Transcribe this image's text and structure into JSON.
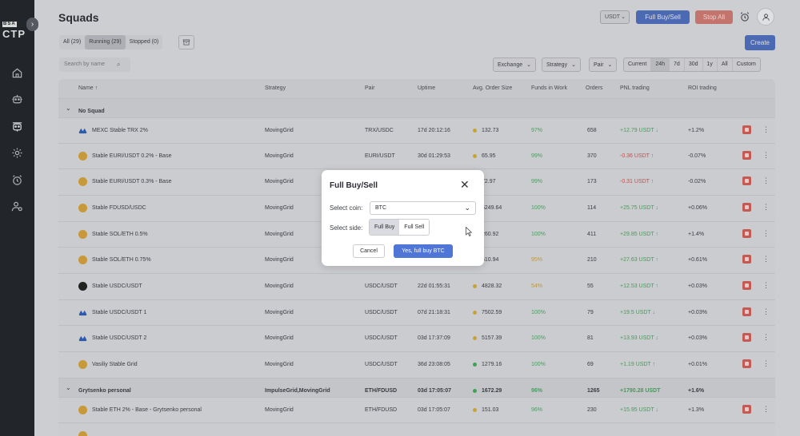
{
  "sidebar": {
    "logo_top": "BSA",
    "logo_main": "CTP",
    "nav": [
      "home-icon",
      "robot-icon",
      "squads-icon",
      "settings-icon",
      "alarm-icon",
      "users-icon"
    ]
  },
  "header": {
    "title": "Squads",
    "currency": "USDT",
    "full_buy_sell": "Full Buy/Sell",
    "stop_all": "Stop All"
  },
  "tabs": [
    {
      "label": "All (29)"
    },
    {
      "label": "Running (29)"
    },
    {
      "label": "Stopped (0)"
    }
  ],
  "create_label": "Create",
  "search": {
    "placeholder": "Search by name"
  },
  "filters": {
    "exchange": "Exchange",
    "strategy": "Strategy",
    "pair": "Pair"
  },
  "periods": [
    "Current",
    "24h",
    "7d",
    "30d",
    "1y",
    "All",
    "Custom"
  ],
  "columns": {
    "name": "Name ↑",
    "strategy": "Strategy",
    "pair": "Pair",
    "uptime": "Uptime",
    "avg": "Avg. Order Size",
    "funds": "Funds in Work",
    "orders": "Orders",
    "pnl": "PNL trading",
    "roi": "ROI trading"
  },
  "groups": [
    {
      "name": "No Squad",
      "strategy": "",
      "pair": "",
      "uptime": "",
      "avg": "",
      "funds": "",
      "orders": "",
      "pnl": "",
      "roi": ""
    },
    {
      "name": "Grytsenko personal",
      "strategy": "ImpulseGrid,MovingGrid",
      "pair": "ETH/FDUSD",
      "uptime": "03d 17:05:07",
      "avg": "1672.29",
      "funds": "96%",
      "orders": "1265",
      "pnl": "+1790.28 USDT",
      "roi": "+1.6%"
    }
  ],
  "rows": [
    {
      "name": "MEXC Stable TRX 2%",
      "strategy": "MovingGrid",
      "pair": "TRX/USDC",
      "uptime": "17d 20:12:16",
      "avg": "132.73",
      "funds": "97%",
      "orders": "658",
      "pnl": "+12.79 USDT ↓",
      "roi": "+1.2%"
    },
    {
      "name": "Stable EURI/USDT 0.2% - Base",
      "strategy": "MovingGrid",
      "pair": "EURI/USDT",
      "uptime": "30d 01:29:53",
      "avg": "65.95",
      "funds": "99%",
      "orders": "370",
      "pnl": "-0.36 USDT ↑",
      "roi": "-0.07%"
    },
    {
      "name": "Stable EURI/USDT 0.3% - Base",
      "strategy": "MovingGrid",
      "pair": "",
      "uptime": "",
      "avg": "72.97",
      "funds": "99%",
      "orders": "173",
      "pnl": "-0.31 USDT ↑",
      "roi": "-0.02%"
    },
    {
      "name": "Stable FDUSD/USDC",
      "strategy": "MovingGrid",
      "pair": "",
      "uptime": "",
      "avg": "5249.64",
      "funds": "100%",
      "orders": "114",
      "pnl": "+25.75 USDT ↓",
      "roi": "+0.06%"
    },
    {
      "name": "Stable SOL/ETH 0.5%",
      "strategy": "MovingGrid",
      "pair": "",
      "uptime": "",
      "avg": "260.92",
      "funds": "100%",
      "orders": "411",
      "pnl": "+29.85 USDT ↑",
      "roi": "+1.4%"
    },
    {
      "name": "Stable SOL/ETH 0.75%",
      "strategy": "MovingGrid",
      "pair": "",
      "uptime": "",
      "avg": "510.94",
      "funds": "95%",
      "orders": "210",
      "pnl": "+27.63 USDT ↑",
      "roi": "+0.61%"
    },
    {
      "name": "Stable USDC/USDT",
      "strategy": "MovingGrid",
      "pair": "USDC/USDT",
      "uptime": "22d 01:55:31",
      "avg": "4828.32",
      "funds": "54%",
      "orders": "55",
      "pnl": "+12.53 USDT ↑",
      "roi": "+0.03%"
    },
    {
      "name": "Stable USDC/USDT 1",
      "strategy": "MovingGrid",
      "pair": "USDC/USDT",
      "uptime": "07d 21:18:31",
      "avg": "7502.59",
      "funds": "100%",
      "orders": "79",
      "pnl": "+19.5 USDT ↓",
      "roi": "+0.03%"
    },
    {
      "name": "Stable USDC/USDT 2",
      "strategy": "MovingGrid",
      "pair": "USDC/USDT",
      "uptime": "03d 17:37:09",
      "avg": "5157.39",
      "funds": "100%",
      "orders": "81",
      "pnl": "+13.93 USDT ↓",
      "roi": "+0.03%"
    },
    {
      "name": "Vasiliy Stable Grid",
      "strategy": "MovingGrid",
      "pair": "USDC/USDT",
      "uptime": "36d 23:08:05",
      "avg": "1279.16",
      "funds": "100%",
      "orders": "69",
      "pnl": "+1.19 USDT ↑",
      "roi": "+0.01%"
    },
    {
      "name": "Stable ETH 2% - Base - Grytsenko personal",
      "strategy": "MovingGrid",
      "pair": "ETH/FDUSD",
      "uptime": "03d 17:05:07",
      "avg": "151.03",
      "funds": "96%",
      "orders": "230",
      "pnl": "+15.95 USDT ↓",
      "roi": "+1.3%"
    }
  ],
  "modal": {
    "title": "Full Buy/Sell",
    "coin_label": "Select coin:",
    "coin_value": "BTC",
    "side_label": "Select side:",
    "side_buy": "Full Buy",
    "side_sell": "Full Sell",
    "cancel": "Cancel",
    "confirm": "Yes, full buy BTC"
  },
  "colors": {
    "accent": "#4f76d6",
    "danger": "#cf5e58",
    "positive": "#46a55c",
    "negative": "#c9554c",
    "sidebar": "#22252a"
  }
}
